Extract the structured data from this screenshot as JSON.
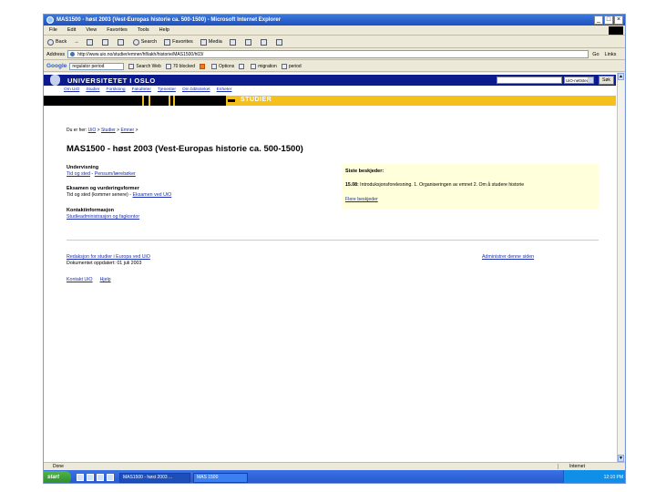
{
  "window": {
    "title": "MAS1500 - høst 2003 (Vest-Europas historie ca. 500-1500) - Microsoft Internet Explorer",
    "controls": [
      "_",
      "□",
      "×"
    ]
  },
  "menu": [
    "File",
    "Edit",
    "View",
    "Favorites",
    "Tools",
    "Help"
  ],
  "toolbar": {
    "back": "Back",
    "forward": "→",
    "search": "Search",
    "favorites": "Favorites",
    "media": "Media"
  },
  "address": {
    "label": "Address",
    "url": "http://www.uio.no/studier/emner/hf/iakh/historie/MAS1500/h03/",
    "go": "Go",
    "links": "Links"
  },
  "google": {
    "logo": "Google",
    "query": "regulator period",
    "search_web": "Search Web",
    "blocked": "70 blocked",
    "options": "Options",
    "migration": "migration",
    "period": "period"
  },
  "uio": {
    "title": "UNIVERSITETET I OSLO",
    "select_value": "UiO-nettsteder",
    "search_button": "Søk",
    "nav": [
      "Om UiO",
      "Studier",
      "Forskning",
      "Fakulteter",
      "Tjenester",
      "Om biblioteket",
      "Enheter"
    ],
    "section": "STUDIER"
  },
  "breadcrumb": {
    "prefix": "Du er her:",
    "items": [
      "UiO",
      "Studier",
      "Emner"
    ]
  },
  "page": {
    "title": "MAS1500 - høst 2003 (Vest-Europas historie ca. 500-1500)",
    "undervisning_head": "Undervisning",
    "undervisning_line": "Tid og sted",
    "undervisning_link": "Pensum/lærebøker",
    "eksamen_head": "Eksamen og vurderingsformer",
    "eksamen_text": "Tid og sted (kommer senere)",
    "eksamen_link": "Eksamen ved UiO",
    "kontakt_head": "Kontaktinformasjon",
    "kontakt_link": "Studieadministrasjon og fagkontor"
  },
  "news": {
    "title": "Siste beskjeder:",
    "item_date": "15.08:",
    "item_text": "Introduksjonsforelesning. 1. Organiseringen av emnet 2. Om å studere historie",
    "more": "Flere beskjeder"
  },
  "footer": {
    "editor": "Redaksjon for studier i Europa ved UiO",
    "updated": "Dokumentet oppdatert: 01 juli 2003",
    "admin": "Administrer denne siden",
    "links": [
      "Kontakt UiO",
      "Hjelp"
    ]
  },
  "status": {
    "text": "Done",
    "zone": "Internet"
  },
  "taskbar": {
    "start": "start",
    "tasks": [
      "MAS1500 - høst 2003 ...",
      "MAS 1500"
    ],
    "clock": "12:10 PM"
  }
}
